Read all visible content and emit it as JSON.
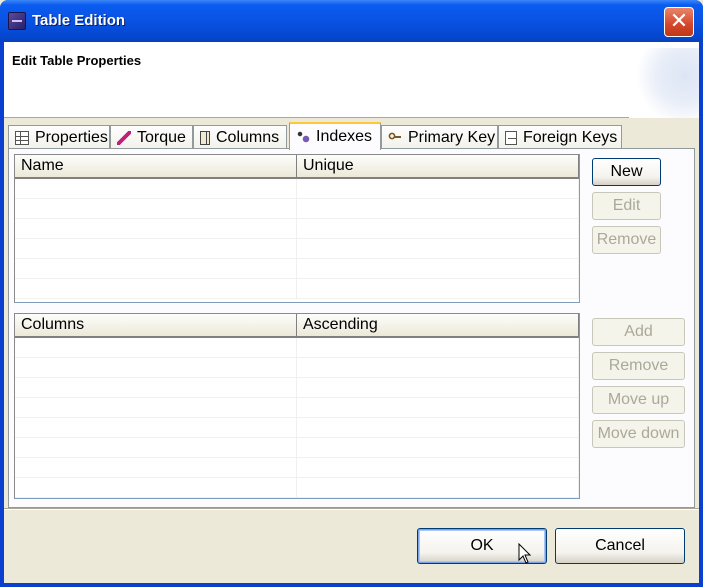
{
  "window": {
    "title": "Table Edition",
    "close_glyph": "✕"
  },
  "header": {
    "title": "Edit Table Properties"
  },
  "tabs": [
    {
      "label": "Properties",
      "icon": "table-grid-icon"
    },
    {
      "label": "Torque",
      "icon": "pen-icon"
    },
    {
      "label": "Columns",
      "icon": "columns-icon"
    },
    {
      "label": "Indexes",
      "icon": "indexes-icon",
      "active": true
    },
    {
      "label": "Primary Key",
      "icon": "key-icon"
    },
    {
      "label": "Foreign Keys",
      "icon": "foreign-key-icon"
    }
  ],
  "indexes_table": {
    "columns": [
      "Name",
      "Unique"
    ]
  },
  "index_buttons": {
    "new": "New",
    "edit": "Edit",
    "remove": "Remove"
  },
  "columns_table": {
    "columns": [
      "Columns",
      "Ascending"
    ]
  },
  "column_buttons": {
    "add": "Add",
    "remove": "Remove",
    "move_up": "Move up",
    "move_down": "Move down"
  },
  "dialog_buttons": {
    "ok": "OK",
    "cancel": "Cancel"
  },
  "colors": {
    "titlebar": "#0a52e3",
    "accent_tab": "#ffc83c",
    "close": "#d5462a"
  }
}
